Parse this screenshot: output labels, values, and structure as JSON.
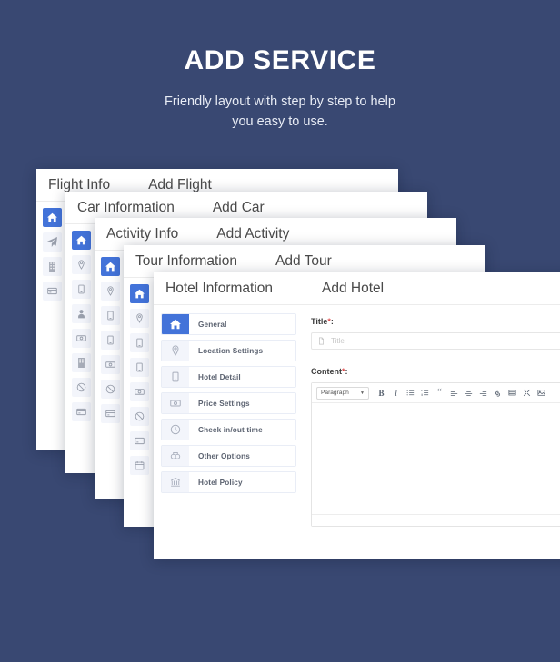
{
  "hero": {
    "title": "ADD SERVICE",
    "subtitle_line1": "Friendly layout with step by step to help",
    "subtitle_line2": "you easy to use."
  },
  "theme": {
    "background": "#394872",
    "accent": "#4373d9",
    "card": "#ffffff",
    "icon_tile": "#f3f5fb",
    "required_mark": "#d44444"
  },
  "cards": [
    {
      "id": "flight",
      "title": "Flight Info",
      "action": "Add Flight",
      "rail_icons": [
        "home-icon",
        "paper-plane-icon",
        "building-icon",
        "credit-card-icon"
      ]
    },
    {
      "id": "car",
      "title": "Car Information",
      "action": "Add Car",
      "rail_icons": [
        "home-icon",
        "location-pin-icon",
        "building-icon",
        "user-icon",
        "money-icon",
        "building-icon",
        "ban-icon",
        "credit-card-icon"
      ]
    },
    {
      "id": "activity",
      "title": "Activity Info",
      "action": "Add Activity",
      "rail_icons": [
        "home-icon",
        "location-pin-icon",
        "building-icon",
        "building-icon",
        "money-icon",
        "ban-icon",
        "credit-card-icon"
      ]
    },
    {
      "id": "tour",
      "title": "Tour Information",
      "action": "Add Tour",
      "rail_icons": [
        "home-icon",
        "location-pin-icon",
        "building-icon",
        "building-icon",
        "money-icon",
        "ban-icon",
        "credit-card-icon",
        "calendar-icon"
      ]
    },
    {
      "id": "hotel",
      "title": "Hotel Information",
      "action": "Add Hotel"
    }
  ],
  "hotel": {
    "nav": [
      {
        "label": "General",
        "icon": "home-icon",
        "active": true
      },
      {
        "label": "Location Settings",
        "icon": "location-pin-icon",
        "active": false
      },
      {
        "label": "Hotel Detail",
        "icon": "building-icon",
        "active": false
      },
      {
        "label": "Price Settings",
        "icon": "money-icon",
        "active": false
      },
      {
        "label": "Check in/out time",
        "icon": "clock-icon",
        "active": false
      },
      {
        "label": "Other Options",
        "icon": "options-icon",
        "active": false
      },
      {
        "label": "Hotel Policy",
        "icon": "bank-icon",
        "active": false
      }
    ],
    "form": {
      "title_label": "Title",
      "title_required": "*",
      "title_colon": ":",
      "title_placeholder": "Title",
      "title_value": "",
      "content_label": "Content",
      "content_required": "*",
      "content_colon": ":",
      "editor": {
        "format_value": "Paragraph",
        "buttons": [
          {
            "name": "bold-button",
            "glyph": "B"
          },
          {
            "name": "italic-button",
            "glyph": "I"
          },
          {
            "name": "bullet-list-button",
            "glyph": ""
          },
          {
            "name": "numbered-list-button",
            "glyph": ""
          },
          {
            "name": "blockquote-button",
            "glyph": "“"
          },
          {
            "name": "align-left-button",
            "glyph": ""
          },
          {
            "name": "align-center-button",
            "glyph": ""
          },
          {
            "name": "align-right-button",
            "glyph": ""
          },
          {
            "name": "link-button",
            "glyph": ""
          },
          {
            "name": "table-button",
            "glyph": ""
          },
          {
            "name": "fullscreen-button",
            "glyph": ""
          },
          {
            "name": "insert-image-button",
            "glyph": ""
          }
        ],
        "body_text": ""
      }
    }
  }
}
